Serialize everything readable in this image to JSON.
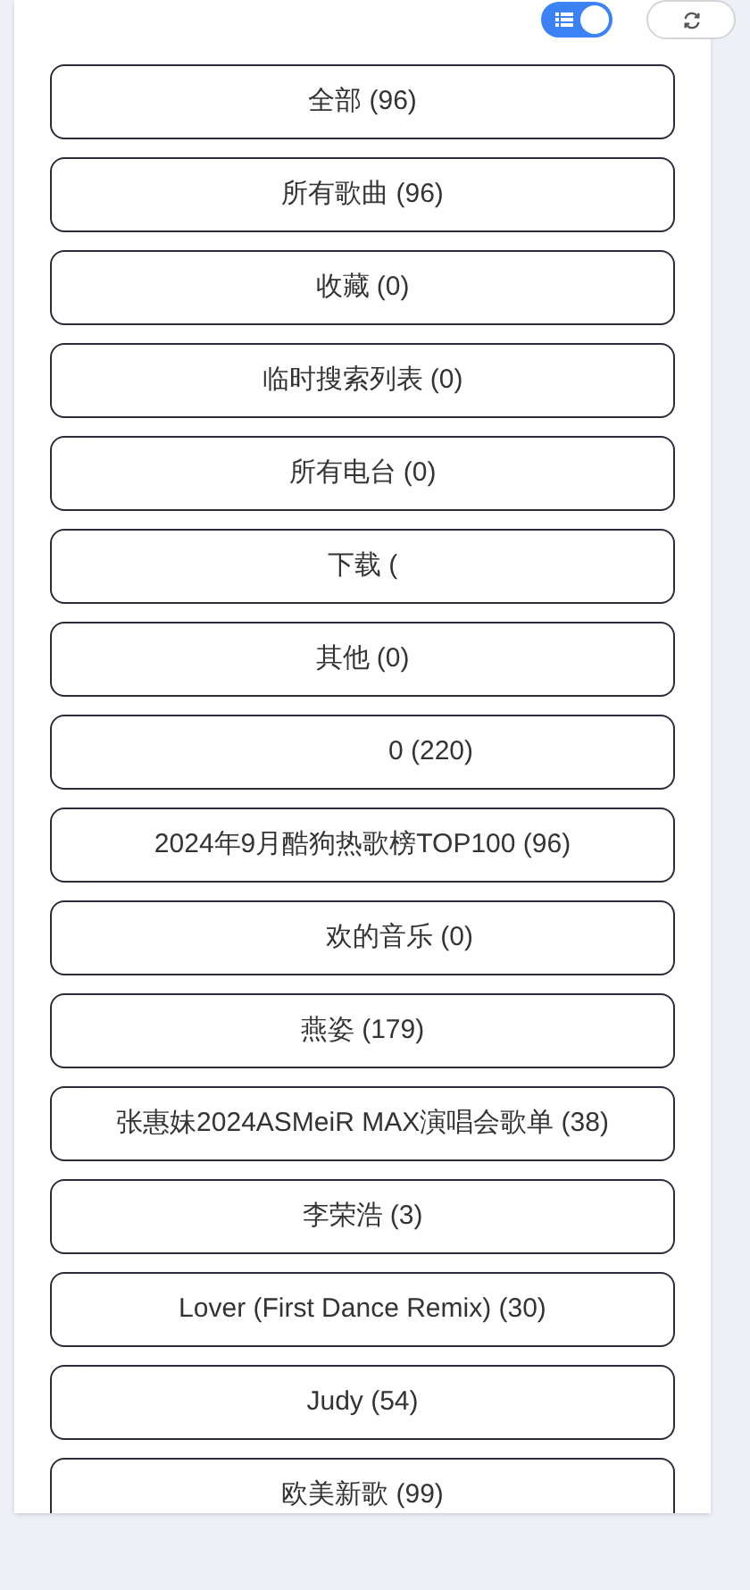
{
  "toolbar": {
    "list_toggle": {
      "on": true
    }
  },
  "playlists": [
    {
      "label": "全部 (96)"
    },
    {
      "label": "所有歌曲 (96)"
    },
    {
      "label": "收藏 (0)"
    },
    {
      "label": "临时搜索列表 (0)"
    },
    {
      "label": "所有电台 (0)"
    },
    {
      "label": "下载 ("
    },
    {
      "label": "其他 (0)"
    },
    {
      "label": "0 (220)",
      "kind": "masked"
    },
    {
      "label": "2024年9月酷狗热歌榜TOP100 (96)"
    },
    {
      "label": "欢的音乐 (0)",
      "kind": "masked"
    },
    {
      "label": "燕姿 (179)"
    },
    {
      "label": "张惠妹2024ASMeiR MAX演唱会歌单 (38)"
    },
    {
      "label": "李荣浩 (3)"
    },
    {
      "label": "Lover (First Dance Remix) (30)"
    },
    {
      "label": "Judy (54)"
    },
    {
      "label": "欧美新歌 (99)"
    }
  ]
}
